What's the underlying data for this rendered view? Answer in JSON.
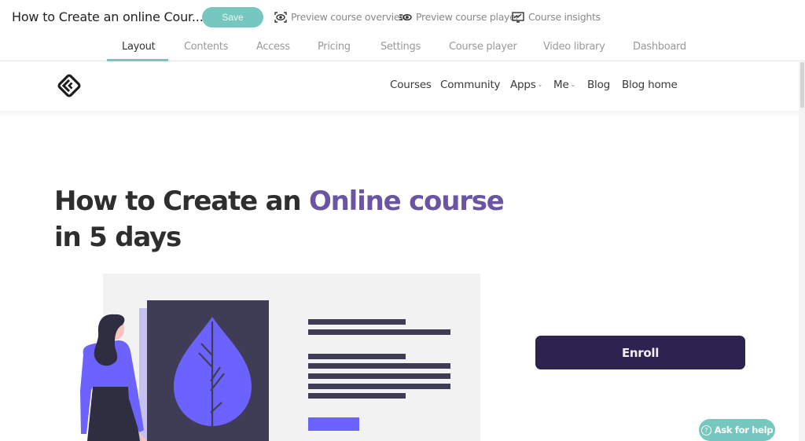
{
  "topbar": {
    "course_title": "How to Create an online Cour...",
    "save_label": "Save",
    "links": [
      {
        "icon": "eye-scan-icon",
        "label": "Preview course overview"
      },
      {
        "icon": "eye-list-icon",
        "label": "Preview course player"
      },
      {
        "icon": "chart-monitor-icon",
        "label": "Course insights"
      }
    ]
  },
  "tabs": [
    {
      "label": "Layout",
      "active": true
    },
    {
      "label": "Contents",
      "active": false
    },
    {
      "label": "Access",
      "active": false
    },
    {
      "label": "Pricing",
      "active": false
    },
    {
      "label": "Settings",
      "active": false
    },
    {
      "label": "Course player",
      "active": false
    },
    {
      "label": "Video library",
      "active": false
    },
    {
      "label": "Dashboard",
      "active": false
    }
  ],
  "site": {
    "logo_icon": "diamond-logo-icon",
    "nav": [
      {
        "label": "Courses",
        "dropdown": false
      },
      {
        "label": "Community",
        "dropdown": false
      },
      {
        "label": "Apps",
        "dropdown": true
      },
      {
        "label": "Me",
        "dropdown": true
      },
      {
        "label": "Blog",
        "dropdown": false
      },
      {
        "label": "Blog home",
        "dropdown": false
      }
    ],
    "chevron": "⌄"
  },
  "hero": {
    "title_prefix": "How to Create an ",
    "title_accent": "Online course",
    "title_suffix": " in 5 days",
    "enroll_label": "Enroll"
  },
  "help": {
    "icon": "?",
    "label": "Ask for help"
  },
  "colors": {
    "accent_teal": "#75c7bf",
    "accent_purple": "#6a55a3",
    "enroll_bg": "#2d2250",
    "illustration_purple": "#6c63ff",
    "illustration_dark": "#3f3d56"
  }
}
